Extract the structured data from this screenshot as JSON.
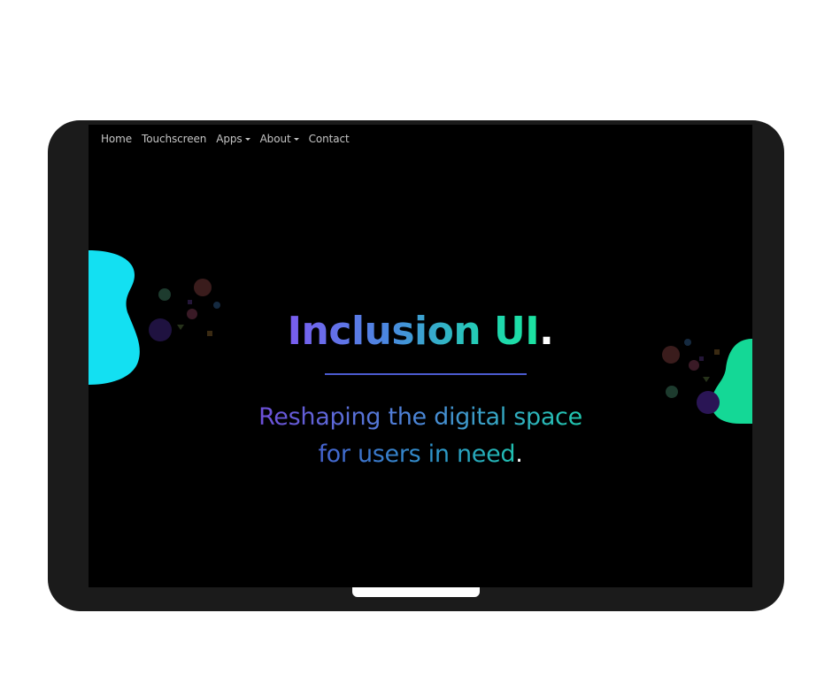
{
  "nav": {
    "items": [
      {
        "label": "Home",
        "has_dropdown": false
      },
      {
        "label": "Touchscreen",
        "has_dropdown": false
      },
      {
        "label": "Apps",
        "has_dropdown": true
      },
      {
        "label": "About",
        "has_dropdown": true
      },
      {
        "label": "Contact",
        "has_dropdown": false
      }
    ]
  },
  "hero": {
    "title": "Inclusion UI",
    "title_dot": ".",
    "subtitle_line1": "Reshaping the digital space",
    "subtitle_line2": "for users in need",
    "subtitle_dot": "."
  },
  "colors": {
    "left_blob": "#13e0f2",
    "right_blob": "#14d896",
    "divider": "#4b5bd0",
    "background": "#000000",
    "device_frame": "#1b1b1b"
  },
  "icons": {
    "dropdown": "caret-down-icon"
  }
}
